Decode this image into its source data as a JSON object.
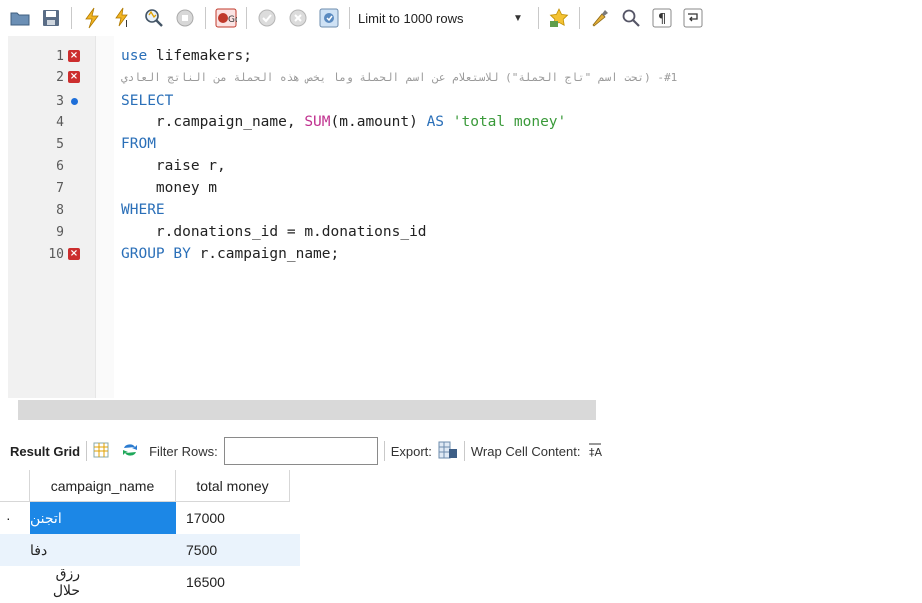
{
  "toolbar": {
    "icons": [
      "folder-icon",
      "save-icon",
      "execute-lightning-icon",
      "execute-cursor-icon",
      "explain-icon",
      "stop-icon",
      "toggle-error-icon",
      "commit-icon",
      "rollback-icon",
      "autocommit-icon",
      "add-snippet-icon",
      "beautify-icon",
      "find-icon",
      "invisible-chars-icon",
      "wrap-icon"
    ],
    "limit_label": "Limit to 1000 rows"
  },
  "editor": {
    "lines": [
      {
        "num": "1",
        "marker": "error"
      },
      {
        "num": "2",
        "marker": "error"
      },
      {
        "num": "3",
        "marker": "dot"
      },
      {
        "num": "4",
        "marker": ""
      },
      {
        "num": "5",
        "marker": ""
      },
      {
        "num": "6",
        "marker": ""
      },
      {
        "num": "7",
        "marker": ""
      },
      {
        "num": "8",
        "marker": ""
      },
      {
        "num": "9",
        "marker": ""
      },
      {
        "num": "10",
        "marker": "error"
      }
    ],
    "code": {
      "l1_kw": "use",
      "l1_rest": " lifemakers;",
      "l2_comment": "#1- (تحت اسم \"تاج الحملة\") للاستعلام عن اسم الحملة وما يخص هذه الحملة من الناتج العادي",
      "l3_kw": "SELECT",
      "l4_a": "    r.campaign_name, ",
      "l4_fn": "SUM",
      "l4_b": "(m.amount) ",
      "l4_kw": "AS",
      "l4_space": " ",
      "l4_str": "'total money'",
      "l5_kw": "FROM",
      "l6": "    raise r,",
      "l7": "    money m",
      "l8_kw": "WHERE",
      "l9": "    r.donations_id = m.donations_id",
      "l10_kw": "GROUP BY",
      "l10_rest": " r.campaign_name;"
    }
  },
  "result": {
    "grid_label": "Result Grid",
    "filter_label": "Filter Rows:",
    "filter_value": "",
    "export_label": "Export:",
    "wrap_label": "Wrap Cell Content:",
    "columns": [
      "campaign_name",
      "total money"
    ],
    "rows": [
      {
        "name": "اتجنن",
        "total": "17000",
        "selected": true
      },
      {
        "name": "دفا",
        "total": "7500",
        "selected": false
      },
      {
        "name": "رزق حلال",
        "total": "16500",
        "selected": false
      }
    ],
    "selected_cell_color": "#1c87e6",
    "alt_row_color": "#eaf3fc"
  }
}
